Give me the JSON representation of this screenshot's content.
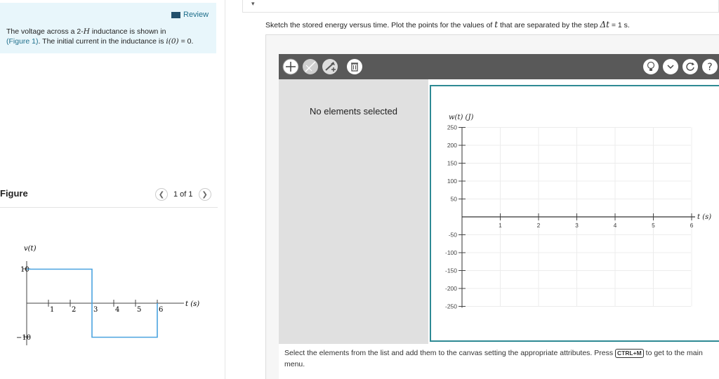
{
  "review": {
    "label": "Review"
  },
  "problem": {
    "line1_pre": "The voltage across a 2-",
    "line1_sym": "H",
    "line1_post": " inductance is shown in",
    "figure_link": "(Figure 1)",
    "line2_mid": ". The initial current in the inductance is ",
    "line2_sym": "i(0)",
    "line2_post": " = 0."
  },
  "figure": {
    "label": "Figure",
    "pager": "1 of 1",
    "prev_icon": "chevron-left-icon",
    "next_icon": "chevron-right-icon",
    "ylabel": "v(t)",
    "xlabel": "t (s)",
    "y_ticks": [
      "10",
      "−10"
    ],
    "x_ticks": [
      "1",
      "2",
      "3",
      "4",
      "5",
      "6"
    ],
    "chart_data": {
      "type": "line",
      "step": true,
      "x": [
        0,
        3,
        3,
        6,
        6
      ],
      "y": [
        10,
        10,
        -10,
        -10,
        0
      ],
      "xlim": [
        0,
        6.3
      ],
      "ylim": [
        -10,
        10
      ],
      "color": "#4aa3df"
    }
  },
  "instruction": {
    "pre": "Sketch the stored energy versus time. Plot the points for the values of ",
    "sym_t": "t",
    "mid": " that are separated by the step ",
    "sym_dt": "Δt",
    "post": " = 1 s."
  },
  "toolbar": {
    "left_icons": [
      "plus-icon",
      "line-tool-icon",
      "add-vector-icon",
      "delete-icon"
    ],
    "right_icons": [
      "hint-bulb-icon",
      "chevron-down-icon",
      "reset-icon",
      "help-icon"
    ]
  },
  "elements_panel": {
    "empty_text": "No elements selected"
  },
  "graph": {
    "ylabel": "w(t) (J)",
    "xlabel": "t (s)",
    "y_ticks": [
      "250",
      "200",
      "150",
      "100",
      "50",
      "-50",
      "-100",
      "-150",
      "-200",
      "-250"
    ],
    "x_ticks": [
      "1",
      "2",
      "3",
      "4",
      "5",
      "6"
    ],
    "chart_data": {
      "type": "scatter",
      "points": [],
      "xlim": [
        0,
        6
      ],
      "ylim": [
        -250,
        250
      ]
    }
  },
  "help": {
    "pre": "Select the elements from the list and add them to the canvas setting the appropriate attributes. Press ",
    "key": "CTRL+M",
    "post": " to get to the main menu."
  },
  "colors": {
    "accent": "#2e8a94",
    "link": "#1f6f8b",
    "toolbar": "#595959",
    "panel": "#e0e0e0",
    "problem_bg": "#e8f6fb"
  }
}
